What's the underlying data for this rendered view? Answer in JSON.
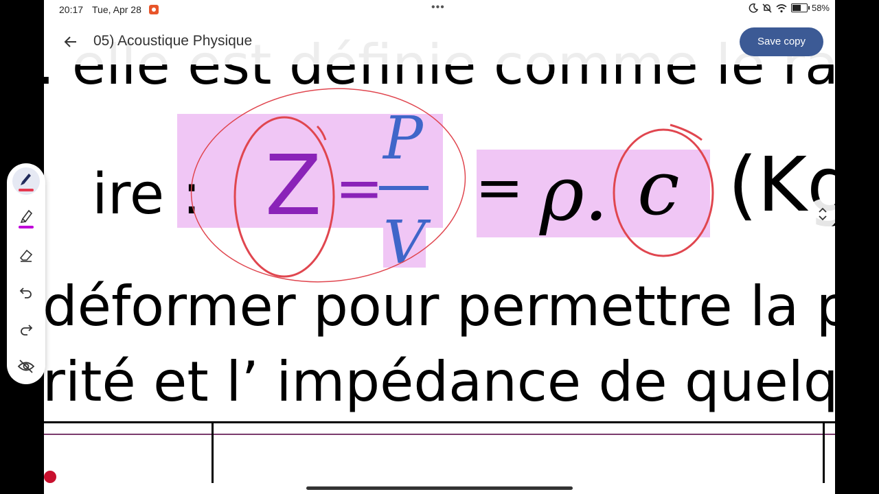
{
  "status_bar": {
    "time": "20:17",
    "date": "Tue, Apr 28",
    "menu_dots": "•••",
    "battery": "58%"
  },
  "app_bar": {
    "title": "05) Acoustique Physique",
    "save_label": "Save copy",
    "accent_color": "#3c5a95"
  },
  "document": {
    "line1": ". elle est définie comme le rapp",
    "label": "ire :",
    "eq_z": "Z",
    "eq_equals": "=",
    "eq_numerator": "P",
    "eq_denominator": "V",
    "eq_rho": "ρ.",
    "eq_c": "c",
    "eq_unit_partial": "(Kg",
    "line3": "déformer pour permettre la pr",
    "line4": "rité et l’ impédance de quelque"
  },
  "toolbar": {
    "tools": [
      {
        "name": "pen-tool",
        "color": "#e53950"
      },
      {
        "name": "highlighter-tool",
        "color": "#c000d9"
      },
      {
        "name": "eraser-tool"
      },
      {
        "name": "undo-tool"
      },
      {
        "name": "redo-tool"
      },
      {
        "name": "hide-annotations-tool"
      }
    ]
  },
  "colors": {
    "highlight": "#f0c6f5",
    "ink_red": "#e0464f",
    "purple_text": "#8a23b8",
    "blue_text": "#3f66c9"
  }
}
